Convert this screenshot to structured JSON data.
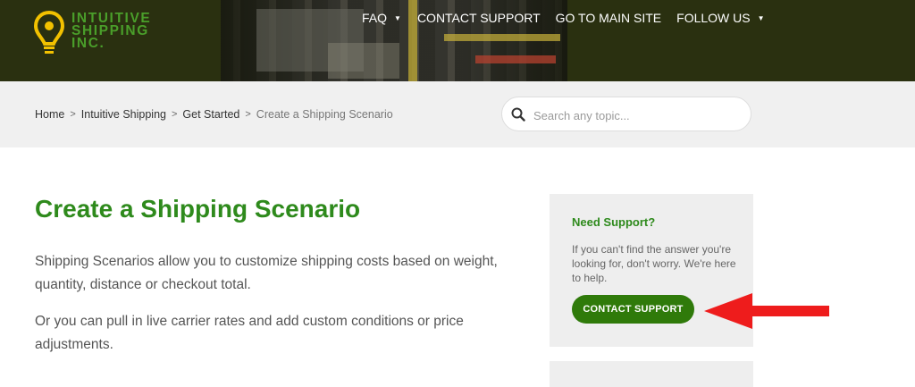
{
  "brand": {
    "logo_text": "INTUITIVE\nSHIPPING\nINC.",
    "logo_color": "#4a9e2a",
    "pin_color": "#f2c100",
    "header_bg": "#2a3010"
  },
  "nav": {
    "items": [
      {
        "label": "FAQ",
        "has_dropdown": true
      },
      {
        "label": "CONTACT SUPPORT",
        "has_dropdown": false
      },
      {
        "label": "GO TO MAIN SITE",
        "has_dropdown": false
      },
      {
        "label": "FOLLOW US",
        "has_dropdown": true
      }
    ]
  },
  "breadcrumb": {
    "items": [
      "Home",
      "Intuitive Shipping",
      "Get Started"
    ],
    "current": "Create a Shipping Scenario"
  },
  "search": {
    "placeholder": "Search any topic...",
    "icon": "search-icon"
  },
  "article": {
    "title": "Create a Shipping Scenario",
    "paragraphs": [
      "Shipping Scenarios allow you to customize shipping costs based on weight, quantity, distance or checkout total.",
      "Or you can pull in live carrier rates and add custom conditions or price adjustments."
    ]
  },
  "sidebar": {
    "support_title": "Need Support?",
    "support_text": "If you can't find the answer you're looking for, don't worry. We're here to help.",
    "support_button": "CONTACT SUPPORT"
  },
  "colors": {
    "accent_green": "#2e8a1c",
    "button_green": "#2f7a0a",
    "annotation_arrow": "#ee1c1c"
  }
}
